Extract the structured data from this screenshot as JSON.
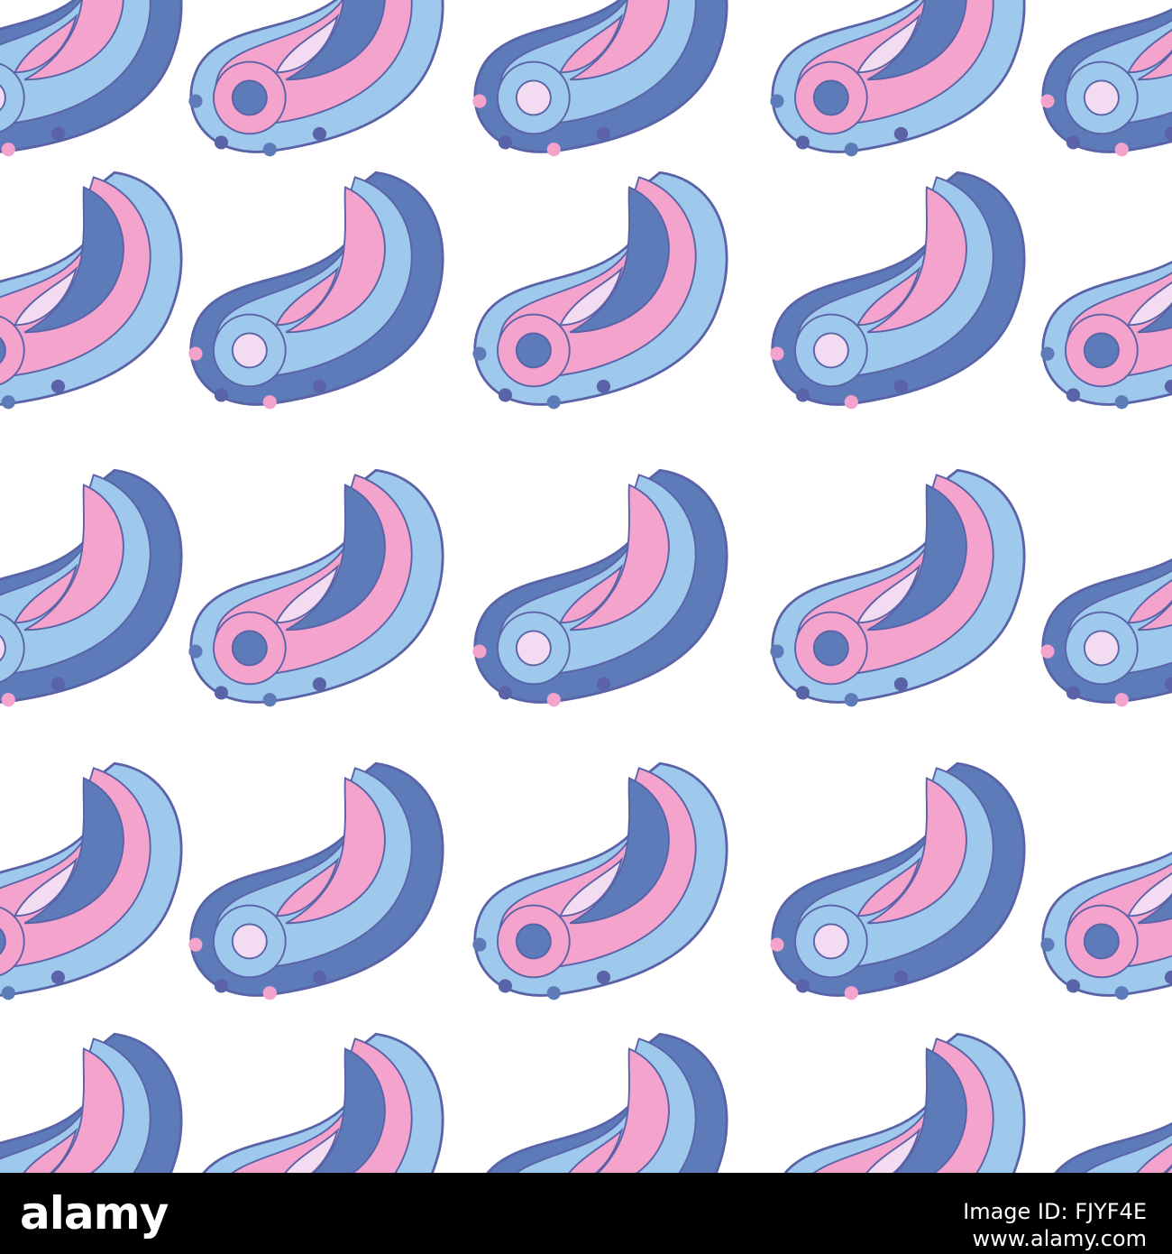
{
  "footer": {
    "brand_logo": "alamy",
    "image_id_line1": "Image ID: FJYF4E",
    "image_id_line2": "www.alamy.com"
  },
  "pattern": {
    "background": "#ffffff",
    "colors": {
      "dark_blue": "#5c7bb8",
      "light_blue": "#9ec8ec",
      "pink": "#f4a3cd",
      "pale_pink": "#f3dcf1",
      "outline": "#5a63a8"
    },
    "motif": "paisley-icon"
  }
}
